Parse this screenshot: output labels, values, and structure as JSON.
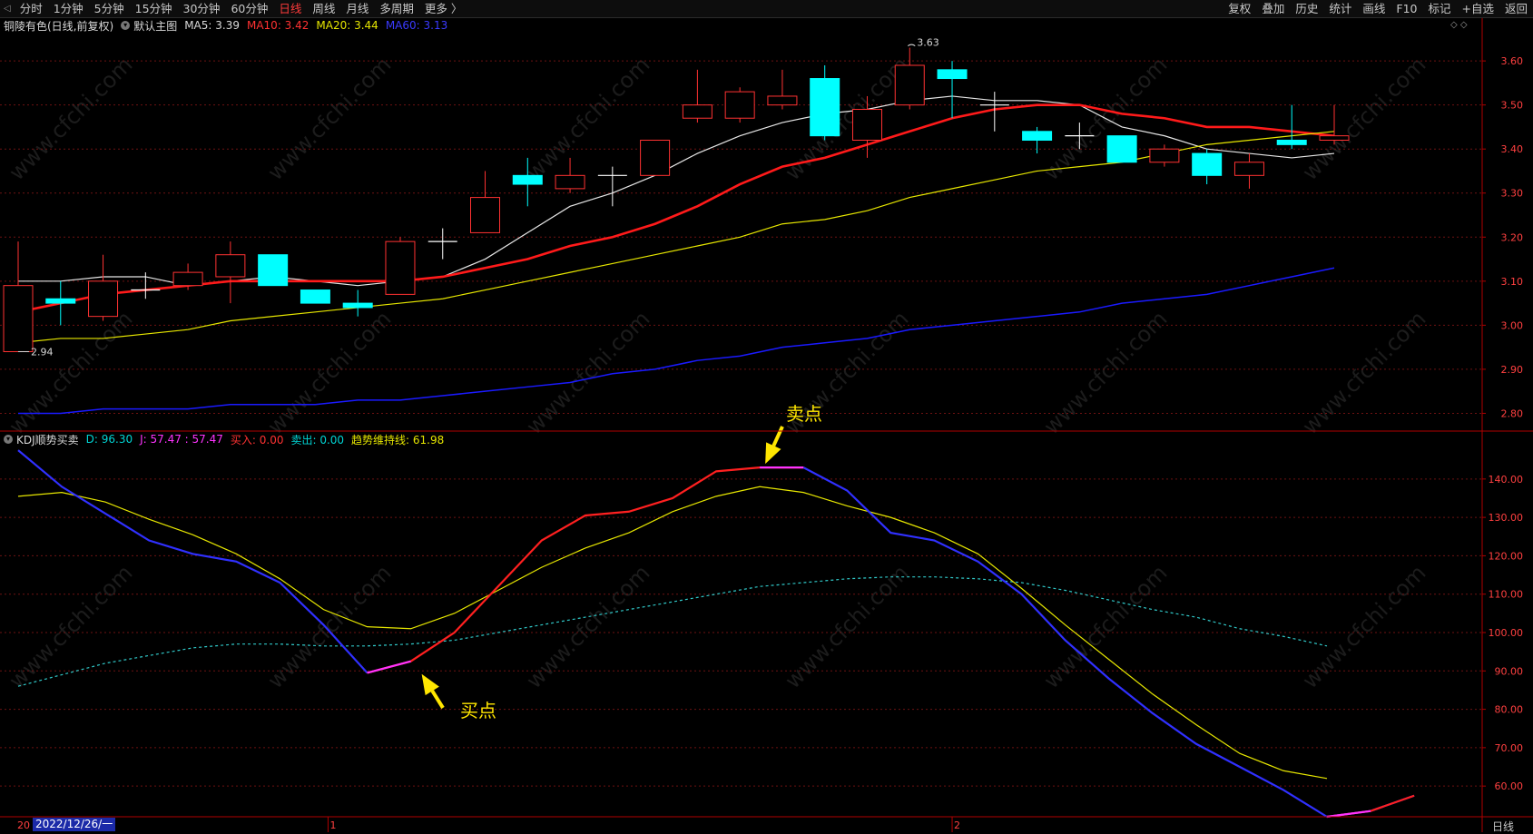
{
  "toolbar": {
    "back_icon": "back-arrow-icon",
    "nav": [
      "分时",
      "1分钟",
      "5分钟",
      "15分钟",
      "30分钟",
      "60分钟",
      "日线",
      "周线",
      "月线",
      "多周期",
      "更多 〉"
    ],
    "active_index": 6,
    "actions": [
      "复权",
      "叠加",
      "历史",
      "统计",
      "画线",
      "F10",
      "标记",
      "+自选",
      "返回"
    ]
  },
  "main_legend": {
    "stock": "铜陵有色(日线,前复权)",
    "template": "默认主图",
    "ma5": "MA5: 3.39",
    "ma10": "MA10: 3.42",
    "ma20": "MA20: 3.44",
    "ma60": "MA60: 3.13"
  },
  "kdj_legend": {
    "name": "KDJ顺势买卖",
    "d": "D: 96.30",
    "j": "J: 57.47 : 57.47",
    "buy": "买入: 0.00",
    "sell": "卖出: 0.00",
    "trend": "趋势维持线: 61.98"
  },
  "colors": {
    "up": "#ff3232",
    "down": "#00ffff",
    "ma5": "#e6e6e6",
    "ma10": "#ff1a1a",
    "ma20": "#e6e600",
    "ma60": "#1a1aff",
    "k": "#3030ff",
    "j": "#ff2020",
    "jhot": "#ff33ff",
    "d": "#e6e600",
    "trend": "#30c8c8",
    "axis": "#b00000",
    "grid": "#6e1212",
    "legend_stock": "#d8d8d8",
    "legend_ma5": "#d8d8d8",
    "legend_ma10": "#ff3232",
    "legend_ma20": "#e6e600",
    "legend_ma60": "#3a3aff",
    "legend_d": "#00d4d4",
    "legend_j": "#ff33ff",
    "legend_buy": "#ff3232",
    "legend_sell": "#00d4d4",
    "legend_trend": "#e6e600"
  },
  "chart_data": [
    {
      "type": "candlestick",
      "title": "铜陵有色(日线,前复权)",
      "y_ticks": [
        3.6,
        3.5,
        3.4,
        3.3,
        3.2,
        3.1,
        3.0,
        2.9,
        2.8
      ],
      "ylim": [
        2.77,
        3.66
      ],
      "low_annotation": "2.94",
      "high_annotation": "3.63",
      "candles": [
        {
          "o": 2.94,
          "h": 3.19,
          "l": 2.94,
          "c": 3.09
        },
        {
          "o": 3.06,
          "h": 3.1,
          "l": 3.0,
          "c": 3.05
        },
        {
          "o": 3.02,
          "h": 3.16,
          "l": 3.01,
          "c": 3.1
        },
        {
          "o": 3.08,
          "h": 3.12,
          "l": 3.06,
          "c": 3.08
        },
        {
          "o": 3.09,
          "h": 3.14,
          "l": 3.08,
          "c": 3.12
        },
        {
          "o": 3.11,
          "h": 3.19,
          "l": 3.05,
          "c": 3.16
        },
        {
          "o": 3.16,
          "h": 3.16,
          "l": 3.09,
          "c": 3.09
        },
        {
          "o": 3.08,
          "h": 3.08,
          "l": 3.05,
          "c": 3.05
        },
        {
          "o": 3.05,
          "h": 3.08,
          "l": 3.02,
          "c": 3.04
        },
        {
          "o": 3.07,
          "h": 3.2,
          "l": 3.07,
          "c": 3.19
        },
        {
          "o": 3.19,
          "h": 3.22,
          "l": 3.15,
          "c": 3.19
        },
        {
          "o": 3.21,
          "h": 3.35,
          "l": 3.21,
          "c": 3.29
        },
        {
          "o": 3.34,
          "h": 3.38,
          "l": 3.27,
          "c": 3.32
        },
        {
          "o": 3.31,
          "h": 3.38,
          "l": 3.3,
          "c": 3.34
        },
        {
          "o": 3.34,
          "h": 3.36,
          "l": 3.27,
          "c": 3.34
        },
        {
          "o": 3.34,
          "h": 3.42,
          "l": 3.34,
          "c": 3.42
        },
        {
          "o": 3.47,
          "h": 3.58,
          "l": 3.46,
          "c": 3.5
        },
        {
          "o": 3.47,
          "h": 3.54,
          "l": 3.46,
          "c": 3.53
        },
        {
          "o": 3.5,
          "h": 3.58,
          "l": 3.49,
          "c": 3.52
        },
        {
          "o": 3.56,
          "h": 3.59,
          "l": 3.42,
          "c": 3.43
        },
        {
          "o": 3.42,
          "h": 3.52,
          "l": 3.38,
          "c": 3.49
        },
        {
          "o": 3.5,
          "h": 3.63,
          "l": 3.49,
          "c": 3.59
        },
        {
          "o": 3.58,
          "h": 3.6,
          "l": 3.47,
          "c": 3.56
        },
        {
          "o": 3.5,
          "h": 3.53,
          "l": 3.44,
          "c": 3.5
        },
        {
          "o": 3.44,
          "h": 3.45,
          "l": 3.39,
          "c": 3.42
        },
        {
          "o": 3.43,
          "h": 3.46,
          "l": 3.4,
          "c": 3.43
        },
        {
          "o": 3.43,
          "h": 3.43,
          "l": 3.37,
          "c": 3.37
        },
        {
          "o": 3.37,
          "h": 3.41,
          "l": 3.36,
          "c": 3.4
        },
        {
          "o": 3.39,
          "h": 3.4,
          "l": 3.32,
          "c": 3.34
        },
        {
          "o": 3.34,
          "h": 3.39,
          "l": 3.31,
          "c": 3.37
        },
        {
          "o": 3.42,
          "h": 3.5,
          "l": 3.4,
          "c": 3.41
        },
        {
          "o": 3.42,
          "h": 3.5,
          "l": 3.41,
          "c": 3.43
        }
      ],
      "series": [
        {
          "name": "MA5",
          "values": [
            3.1,
            3.1,
            3.11,
            3.11,
            3.09,
            3.1,
            3.11,
            3.1,
            3.09,
            3.1,
            3.11,
            3.15,
            3.21,
            3.27,
            3.3,
            3.34,
            3.39,
            3.43,
            3.46,
            3.48,
            3.49,
            3.51,
            3.52,
            3.51,
            3.51,
            3.5,
            3.45,
            3.43,
            3.4,
            3.39,
            3.38,
            3.39
          ]
        },
        {
          "name": "MA10",
          "values": [
            3.03,
            3.05,
            3.07,
            3.08,
            3.09,
            3.1,
            3.1,
            3.1,
            3.1,
            3.1,
            3.11,
            3.13,
            3.15,
            3.18,
            3.2,
            3.23,
            3.27,
            3.32,
            3.36,
            3.38,
            3.41,
            3.44,
            3.47,
            3.49,
            3.5,
            3.5,
            3.48,
            3.47,
            3.45,
            3.45,
            3.44,
            3.43
          ]
        },
        {
          "name": "MA20",
          "values": [
            2.96,
            2.97,
            2.97,
            2.98,
            2.99,
            3.01,
            3.02,
            3.03,
            3.04,
            3.05,
            3.06,
            3.08,
            3.1,
            3.12,
            3.14,
            3.16,
            3.18,
            3.2,
            3.23,
            3.24,
            3.26,
            3.29,
            3.31,
            3.33,
            3.35,
            3.36,
            3.37,
            3.39,
            3.41,
            3.42,
            3.43,
            3.44
          ]
        },
        {
          "name": "MA60",
          "values": [
            2.8,
            2.8,
            2.81,
            2.81,
            2.81,
            2.82,
            2.82,
            2.82,
            2.83,
            2.83,
            2.84,
            2.85,
            2.86,
            2.87,
            2.89,
            2.9,
            2.92,
            2.93,
            2.95,
            2.96,
            2.97,
            2.99,
            3.0,
            3.01,
            3.02,
            3.03,
            3.05,
            3.06,
            3.07,
            3.09,
            3.11,
            3.13
          ]
        }
      ]
    },
    {
      "type": "line",
      "title": "KDJ顺势买卖",
      "y_ticks": [
        140,
        130,
        120,
        110,
        100,
        90,
        80,
        70,
        60
      ],
      "ylim": [
        52,
        148
      ],
      "series": [
        {
          "name": "K",
          "values": [
            147.5,
            138,
            131,
            124,
            120.5,
            118.5,
            113,
            102,
            89.5,
            null,
            null,
            null,
            null,
            null,
            null,
            null,
            null,
            null,
            143,
            137,
            126,
            124,
            118.5,
            110,
            98,
            88,
            79,
            71,
            65,
            59,
            52,
            53.5,
            57.5
          ]
        },
        {
          "name": "J",
          "values": [
            null,
            null,
            null,
            null,
            null,
            null,
            null,
            null,
            89.5,
            92.5,
            100,
            112,
            124,
            130.5,
            131.5,
            135,
            142,
            143,
            143,
            null,
            null,
            null,
            null,
            null,
            null,
            null,
            null,
            null,
            null,
            null,
            52,
            53.5,
            57.5
          ]
        },
        {
          "name": "D",
          "values": [
            135.5,
            136.5,
            134,
            129.5,
            125.5,
            120.5,
            114,
            106,
            101.5,
            101,
            105,
            111,
            117,
            122,
            126,
            131.5,
            135.5,
            138,
            136.5,
            133,
            130,
            126,
            120.5,
            111.5,
            102,
            93,
            84,
            76,
            68.5,
            64,
            61.98
          ]
        },
        {
          "name": "趋势维持线",
          "values": [
            86,
            89,
            92,
            94,
            96,
            97,
            97,
            96.5,
            96.5,
            97,
            98,
            100,
            102,
            104,
            106,
            108,
            110,
            112,
            113,
            114,
            114.5,
            114.5,
            114,
            113,
            111,
            108.5,
            106,
            104,
            101,
            99,
            96.5
          ]
        }
      ],
      "annotations": [
        {
          "text": "卖点"
        },
        {
          "text": "买点"
        }
      ]
    }
  ],
  "x_axis": {
    "start_label": "20",
    "date_cursor": "2022/12/26/一",
    "month_marks": [
      "1",
      "2"
    ]
  },
  "period_tag": "日线",
  "watermark": "www.cfchi.com"
}
